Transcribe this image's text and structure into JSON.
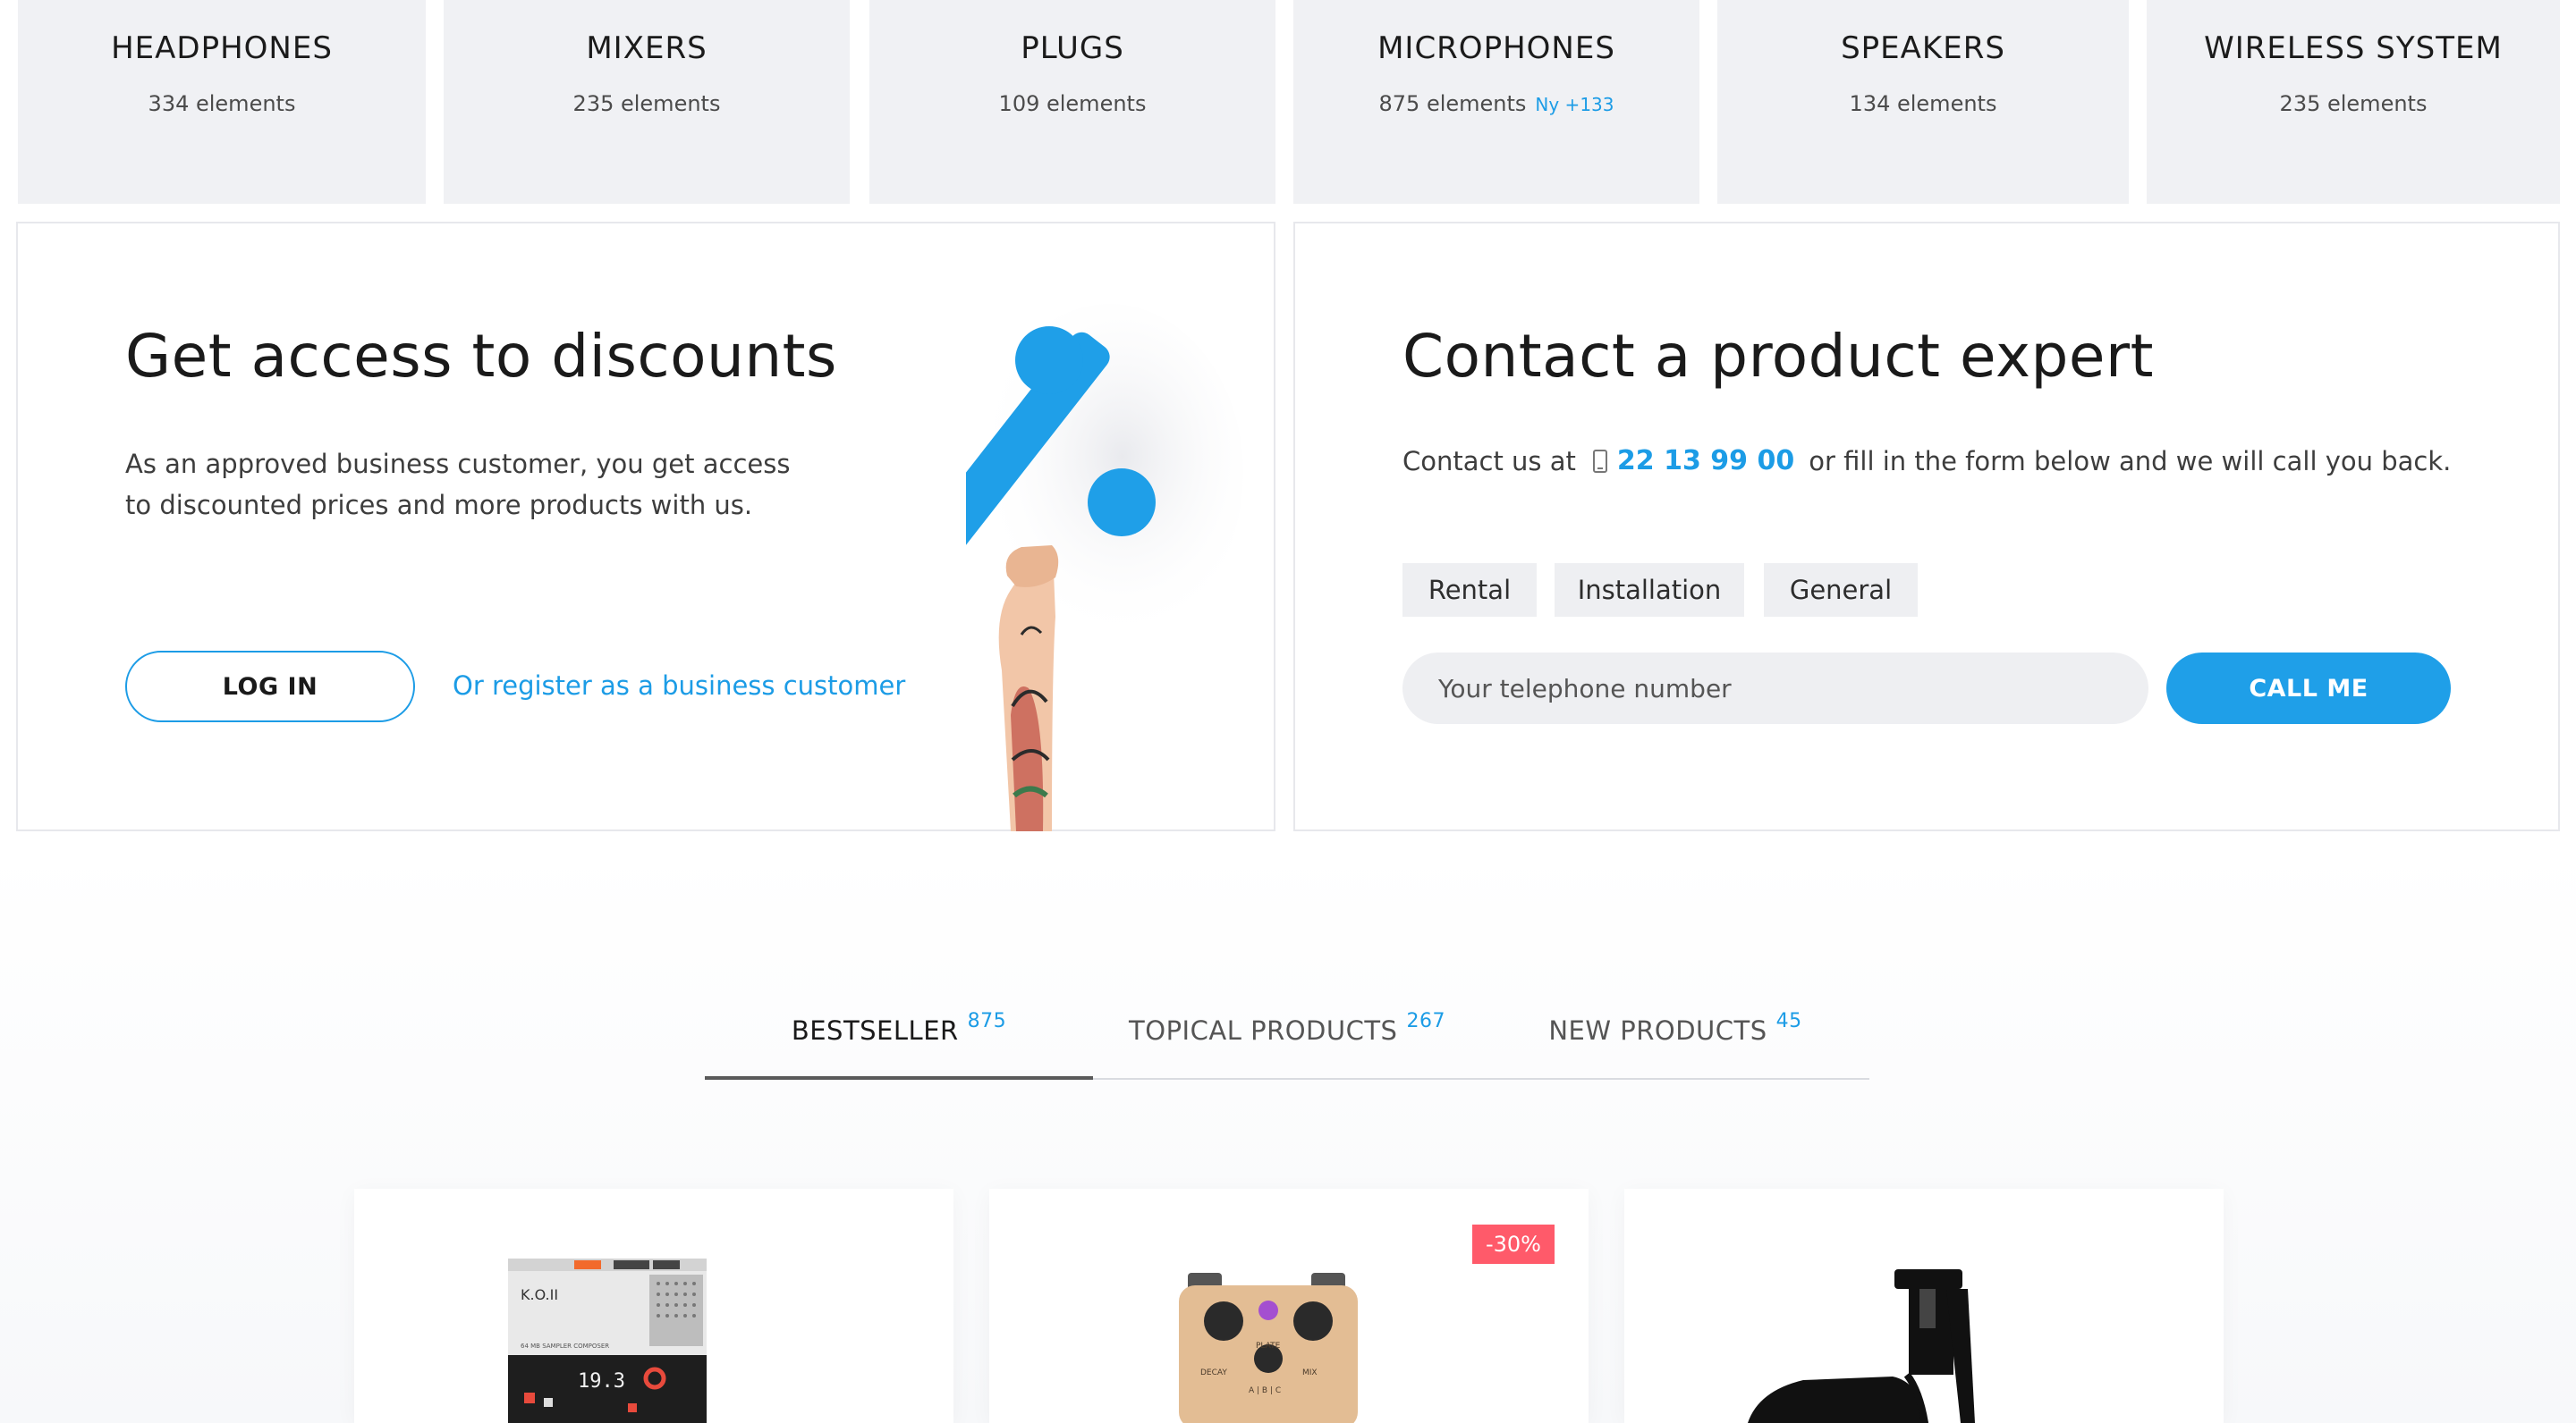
{
  "categories": [
    {
      "name": "HEADPHONES",
      "count": "334 elements",
      "new": ""
    },
    {
      "name": "MIXERS",
      "count": "235 elements",
      "new": ""
    },
    {
      "name": "PLUGS",
      "count": "109 elements",
      "new": ""
    },
    {
      "name": "MICROPHONES",
      "count": "875 elements",
      "new": "Ny +133"
    },
    {
      "name": "SPEAKERS",
      "count": "134 elements",
      "new": ""
    },
    {
      "name": "WIRELESS SYSTEM",
      "count": "235 elements",
      "new": ""
    }
  ],
  "discounts": {
    "title": "Get access to discounts",
    "text": "As an approved business customer, you get access to discounted prices and more products with us.",
    "login_label": "LOG IN",
    "register_label": "Or register as a business customer"
  },
  "contact": {
    "title": "Contact a product expert",
    "prefix": "Contact us at",
    "phone": "22 13 99 00",
    "suffix": "or fill in the form below and we will call you back.",
    "topics": [
      "Rental",
      "Installation",
      "General"
    ],
    "input_placeholder": "Your telephone number",
    "call_label": "CALL ME"
  },
  "tabs": [
    {
      "label": "BESTSELLER",
      "count": "875"
    },
    {
      "label": "TOPICAL PRODUCTS",
      "count": "267"
    },
    {
      "label": "NEW PRODUCTS",
      "count": "45"
    }
  ],
  "products": [
    {
      "name": "K.O.II",
      "subtitle": "64 MB SAMPLER COMPOSER",
      "display": "19.3",
      "badge": ""
    },
    {
      "name": "pedal",
      "badge": "-30%",
      "knobs": [
        "DECAY",
        "PLATE",
        "MIX"
      ],
      "modes": "A | B | C"
    },
    {
      "name": "microphone",
      "badge": ""
    }
  ],
  "colors": {
    "accent": "#1c9ce6",
    "tile_bg": "#f0f1f4",
    "badge": "#ff5a6a"
  }
}
